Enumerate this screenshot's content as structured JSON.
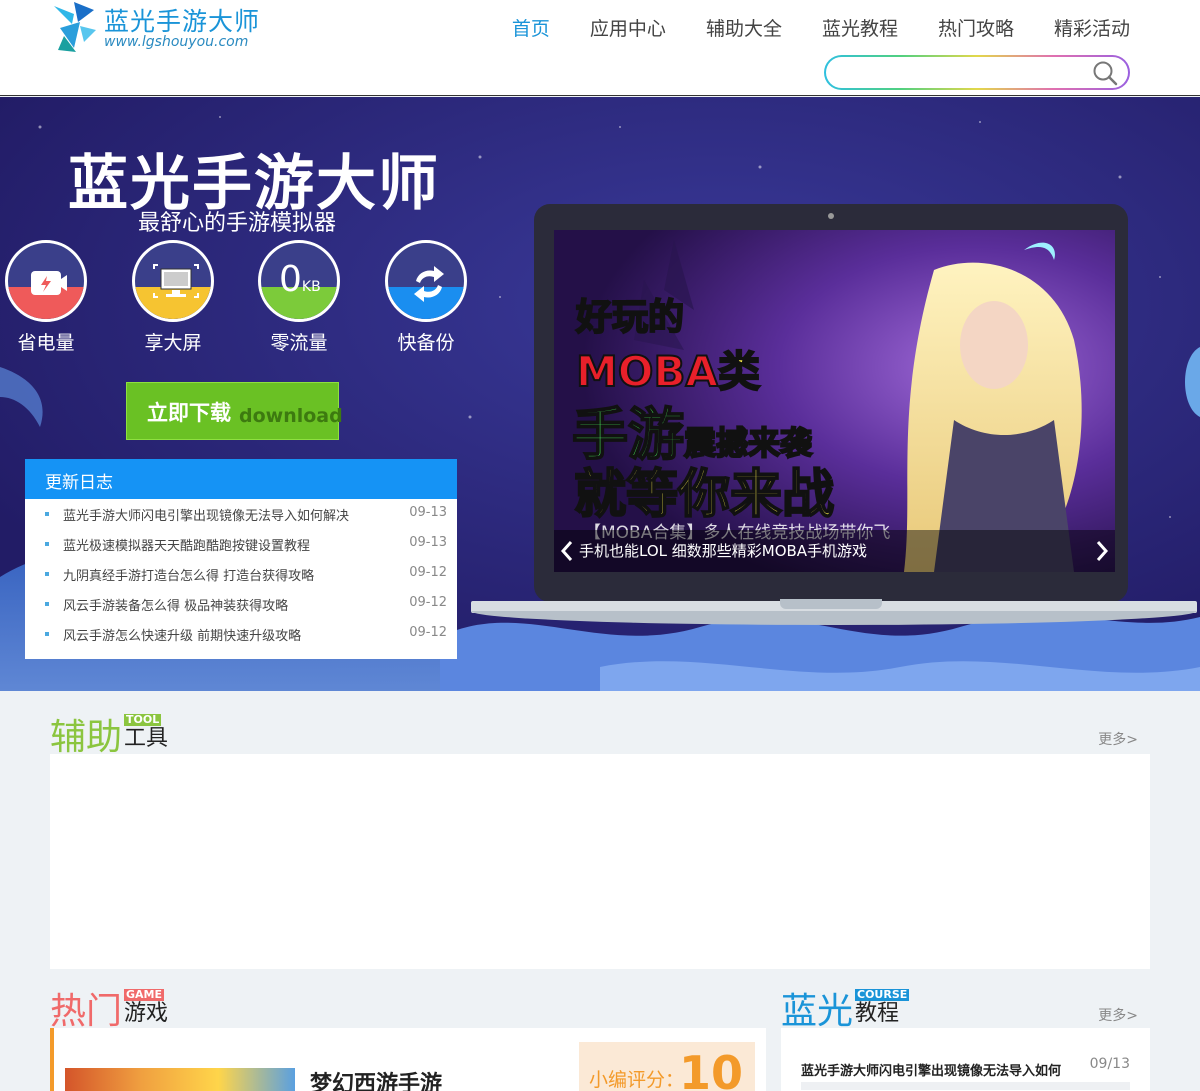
{
  "header": {
    "logo_title": "蓝光手游大师",
    "logo_url": "www.lgshouyou.com",
    "nav": [
      "首页",
      "应用中心",
      "辅助大全",
      "蓝光教程",
      "热门攻略",
      "精彩活动"
    ],
    "active_nav": "首页",
    "search_placeholder": ""
  },
  "banner": {
    "title": "蓝光手游大师",
    "subtitle": "最舒心的手游模拟器",
    "features": [
      {
        "label": "省电量",
        "icon": "battery-video-icon"
      },
      {
        "label": "享大屏",
        "icon": "monitor-icon"
      },
      {
        "label": "零流量",
        "icon": "zero-kb-icon"
      },
      {
        "label": "快备份",
        "icon": "sync-arrows-icon"
      }
    ],
    "zero_kb_text": "0",
    "zero_kb_unit": "KB",
    "download_cn": "立即下载",
    "download_en": "download",
    "changelog": {
      "heading": "更新日志",
      "items": [
        {
          "title": "蓝光手游大师闪电引擎出现镜像无法导入如何解决",
          "date": "09-13"
        },
        {
          "title": "蓝光极速模拟器天天酷跑酷跑按键设置教程",
          "date": "09-13"
        },
        {
          "title": "九阴真经手游打造台怎么得 打造台获得攻略",
          "date": "09-12"
        },
        {
          "title": "风云手游装备怎么得 极品神装获得攻略",
          "date": "09-12"
        },
        {
          "title": "风云手游怎么快速升级 前期快速升级攻略",
          "date": "09-12"
        }
      ]
    },
    "slide": {
      "line1": "好玩的",
      "line2a": "MOBA",
      "line2b": "类",
      "line3a": "手游",
      "line3b": "震撼来袭",
      "line4": "就等你来战",
      "strip": "【MOBA合集】多人在线竞技战场带你飞",
      "caption": "手机也能LOL 细数那些精彩MOBA手机游戏"
    }
  },
  "tool_section": {
    "big": "辅助",
    "tag": "TOOL",
    "small": "工具",
    "more": "更多>"
  },
  "game_section": {
    "big": "热门",
    "tag": "GAME",
    "small": "游戏",
    "game_name": "梦幻西游手游",
    "score_label": "小编评分：",
    "score_value": "10"
  },
  "course_section": {
    "big": "蓝光",
    "tag": "COURSE",
    "small": "教程",
    "more": "更多>",
    "first_title": "蓝光手游大师闪电引擎出现镜像无法导入如何",
    "first_date": "09/13"
  },
  "colors": {
    "brand_blue": "#1a94d8",
    "tool_green": "#8bc53f",
    "game_red": "#f06a6a",
    "course_blue": "#1a94d8",
    "download_green": "#6ac124"
  }
}
